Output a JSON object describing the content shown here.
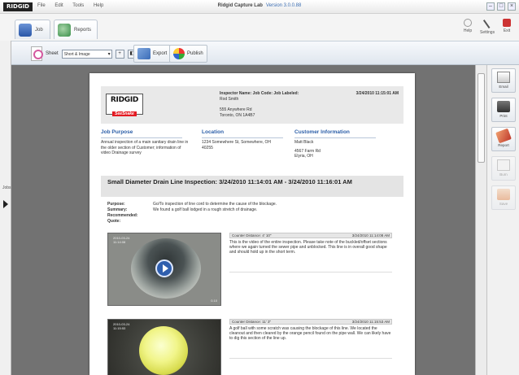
{
  "window": {
    "logo": "RIDGID",
    "menu": [
      "File",
      "Edit",
      "Tools",
      "Help"
    ],
    "title": "Ridgid Capture Lab",
    "version": "Version 3.0.0.88"
  },
  "tabs": [
    {
      "label": "Job"
    },
    {
      "label": "Reports"
    }
  ],
  "top_tools": [
    {
      "label": "Help"
    },
    {
      "label": "Settings"
    },
    {
      "label": "Exit"
    }
  ],
  "toolbar": {
    "sheet_label": "Sheet",
    "sheet_value": "Short & Image",
    "export_label": "Export",
    "publish_label": "Publish"
  },
  "side_panel": {
    "label": "Jobs"
  },
  "report": {
    "brand": "RIDGID",
    "brand_sub": "SeeSnake",
    "inspector_line": "Inspector Name:   Job Code:   Job Labeled:",
    "header_date": "3/24/2010 11:15:01 AM",
    "inspector_name": "Rod Smith",
    "company_addr1": "555 Anywhere Rd",
    "company_addr2": "Toronto, ON 1A4B7",
    "job_purpose_h": "Job Purpose",
    "job_purpose_text": "Annual inspection of a main sanitary drain line in the older section of Customer; information of video Drainage survey",
    "location_h": "Location",
    "location_text": "1234 Somewhere St, Somewhere, OH 40255",
    "customer_h": "Customer Information",
    "customer_name": "Matt Black",
    "customer_addr1": "4567 Farm Rd",
    "customer_addr2": "Elyria, OH",
    "section_title": "Small Diameter Drain Line Inspection: 3/24/2010 11:14:01 AM - 3/24/2010 11:16:01 AM",
    "meta": [
      {
        "k": "Purpose:",
        "v": "Go/To inspection of line cord to determine the cause of the blockage."
      },
      {
        "k": "Summary:",
        "v": "We found a golf ball lodged in a rough stretch of drainage."
      },
      {
        "k": "Recommended:",
        "v": ""
      },
      {
        "k": "Quote:",
        "v": ""
      }
    ],
    "entries": [
      {
        "cam": "Counter Distance:   4' 10\"",
        "time": "3/24/2010 11:14:08 AM",
        "text": "This is the video of the entire inspection. Please take note of the buckled/offset sections where we again turned the sewer pipe and unblocked. This line is in overall good shape and should hold up in the short term.",
        "stamp1": "2010-03-24",
        "stamp2": "11:14:08",
        "stamp3": "0.10"
      },
      {
        "cam": "Counter Distance:   11' 3\"",
        "time": "3/24/2010 11:15:53 AM",
        "text": "A golf ball with some scratch was causing the blockage of this line. We located the cleanout and then cleared by the orange pencil found on the pipe wall. We can likely have to dig this section of the line up.",
        "stamp1": "2010-03-24",
        "stamp2": "11:15:53"
      }
    ]
  },
  "right_tools": [
    {
      "label": "Email",
      "enabled": true
    },
    {
      "label": "Print",
      "enabled": true
    },
    {
      "label": "Report",
      "enabled": true
    },
    {
      "label": "Burn",
      "enabled": false
    },
    {
      "label": "Save",
      "enabled": false
    }
  ]
}
